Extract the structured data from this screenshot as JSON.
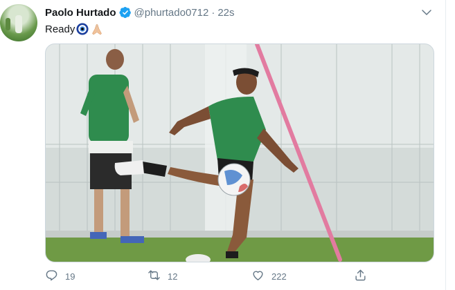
{
  "tweet": {
    "author_name": "Paolo Hurtado",
    "author_handle": "@phurtado0712",
    "separator": "·",
    "timestamp": "22s",
    "text": "Ready",
    "emojis": [
      "nazar-amulet-emoji",
      "folded-hands-emoji"
    ],
    "image_alt": "Soccer player in green training kit kicking a ball on a training pitch",
    "stats": {
      "replies": "19",
      "retweets": "12",
      "likes": "222"
    }
  },
  "colors": {
    "accent": "#1da1f2",
    "secondary_text": "#657786",
    "border": "#ccd6dd"
  },
  "icons": [
    "verified-badge-icon",
    "chevron-down-icon",
    "reply-icon",
    "retweet-icon",
    "like-icon",
    "share-icon"
  ]
}
